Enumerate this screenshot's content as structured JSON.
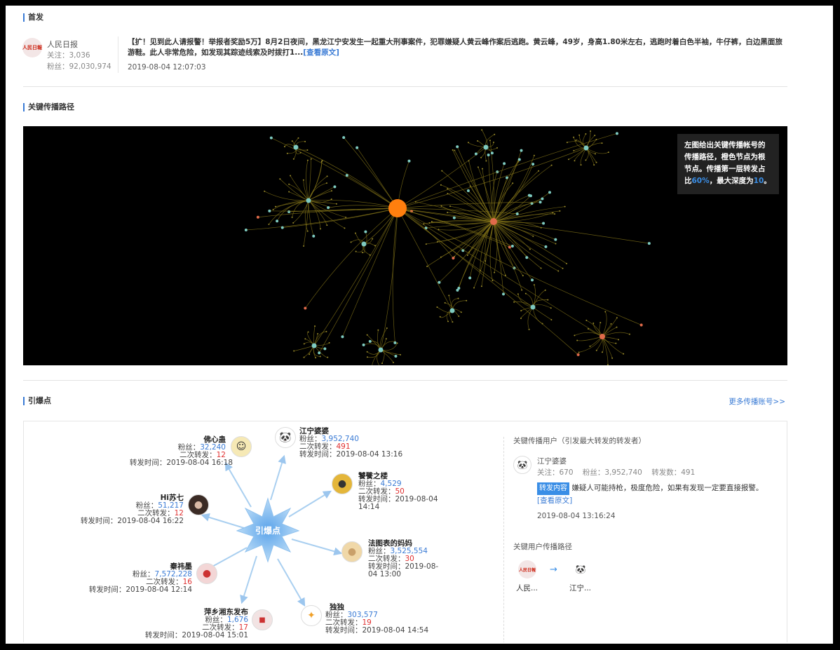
{
  "first": {
    "section_title": "首发",
    "account_name": "人民日报",
    "follow_label": "关注：",
    "follow_value": "3,036",
    "fans_label": "粉丝：",
    "fans_value": "92,030,974",
    "post_text": "【扩！见到此人请报警！举报者奖励5万】8月2日夜间，黑龙江宁安发生一起重大刑事案件，犯罪嫌疑人黄云峰作案后逃跑。黄云峰，49岁，身高1.80米左右，逃跑时着白色半袖，牛仔裤，白边黑面旅游鞋。此人非常危险，如发现其踪迹线索及时拨打1...",
    "view_link": "[查看原文]",
    "post_time": "2019-08-04 12:07:03"
  },
  "path": {
    "section_title": "关键传播路径",
    "legend_a": "左图给出关键传播帐号的传播路径，橙色节点为根节点。传播第一层转发占比",
    "legend_pct": "60%",
    "legend_b": "，最大深度为",
    "legend_depth": "10",
    "legend_c": "。"
  },
  "ignite": {
    "section_title": "引爆点",
    "more_link": "更多传播账号>>",
    "center_label": "引爆点",
    "fans_label": "粉丝：",
    "sec_label": "二次转发：",
    "time_label": "转发时间：",
    "nodes": [
      {
        "name": "佛心蛊",
        "fans": "32,240",
        "sec": "12",
        "time": "2019-08-04 16:18"
      },
      {
        "name": "江宁婆婆",
        "fans": "3,952,740",
        "sec": "491",
        "time": "2019-08-04 13:16"
      },
      {
        "name": "饕餮之楼",
        "fans": "4,529",
        "sec": "50",
        "time_a": "2019-08-04",
        "time_b": "14:14"
      },
      {
        "name": "Hi苏七",
        "fans": "51,217",
        "sec": "12",
        "time": "2019-08-04 16:22"
      },
      {
        "name": "法图表的妈妈",
        "fans": "3,525,554",
        "sec": "30",
        "time_a": "2019-08-",
        "time_b": "04 13:00"
      },
      {
        "name": "秦祎墨",
        "fans": "7,572,228",
        "sec": "16",
        "time": "2019-08-04 12:14"
      },
      {
        "name": "萍乡湘东发布",
        "fans": "1,676",
        "sec": "17",
        "time": "2019-08-04 15:01"
      },
      {
        "name": "独独",
        "fans": "303,577",
        "sec": "19",
        "time": "2019-08-04 14:54"
      }
    ]
  },
  "key_user": {
    "title": "关键传播用户（引发最大转发的转发者）",
    "name": "江宁婆婆",
    "follow_label": "关注：",
    "follow": "670",
    "fans_label": "粉丝：",
    "fans": "3,952,740",
    "repost_label": "转发数：",
    "repost": "491",
    "tag": "转发内容",
    "content": "嫌疑人可能持枪，极度危险，如果有发现一定要直接报警。",
    "view_link": "[查看原文]",
    "time": "2019-08-04 13:16:24",
    "path_title": "关键用户传播路径",
    "path_from": "人民...",
    "path_to": "江宁..."
  },
  "colors": {
    "accent": "#3a7bd5",
    "root": "#ff7f0e",
    "red": "#e03030"
  }
}
